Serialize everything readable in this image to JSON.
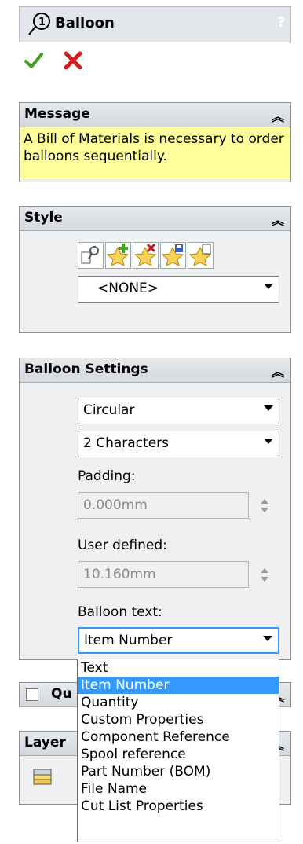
{
  "title": {
    "text": "Balloon",
    "help": "?"
  },
  "actions": {
    "ok": "✔",
    "cancel": "✖"
  },
  "message": {
    "header": "Message",
    "text": "A Bill of Materials is necessary to order balloons sequentially."
  },
  "style": {
    "header": "Style",
    "selected": "<NONE>"
  },
  "settings": {
    "header": "Balloon Settings",
    "shape": "Circular",
    "size": "2 Characters",
    "padding_label": "Padding:",
    "padding_value": "0.000mm",
    "user_defined_label": "User defined:",
    "user_defined_value": "10.160mm",
    "balloon_text_label": "Balloon text:",
    "balloon_text_value": "Item Number"
  },
  "dropdown_options": [
    "Text",
    "Item Number",
    "Quantity",
    "Custom Properties",
    "Component Reference",
    "Spool reference",
    "Part Number (BOM)",
    "File Name",
    "Cut List Properties"
  ],
  "quantity_group": {
    "header": "Qu"
  },
  "layer_group": {
    "header": "Layer"
  },
  "colors": {
    "accent": "#3399ff",
    "message_bg": "#fefe9b"
  }
}
